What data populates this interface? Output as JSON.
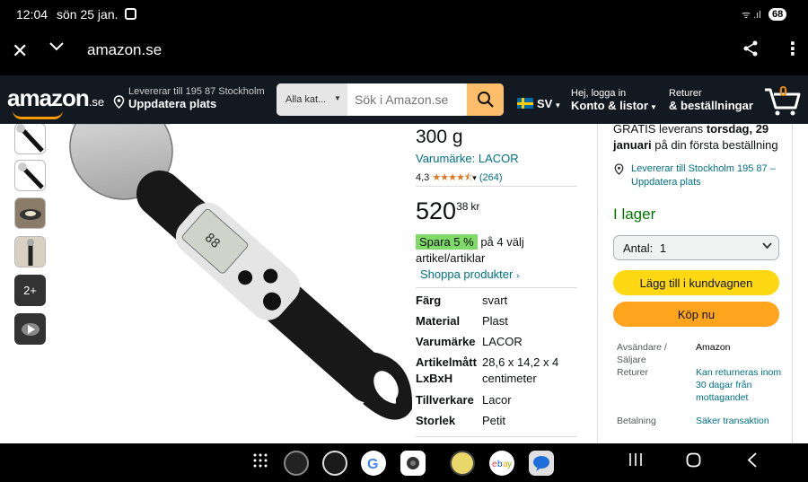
{
  "status": {
    "time": "12:04",
    "date": "sön 25 jan.",
    "signal": "ᯤ .ıl",
    "battery": "68"
  },
  "browser": {
    "close": "✕",
    "chevron": "⌄",
    "url": "amazon.se",
    "share": "⋰",
    "more": "⋮"
  },
  "header": {
    "logo": "amazon",
    "logo_suffix": ".se",
    "deliver_line1": "Levererar till 195 87 Stockholm",
    "deliver_line2": "Uppdatera plats",
    "search_category": "Alla kat...",
    "search_placeholder": "Sök i Amazon.se",
    "lang": "SV",
    "account_line1": "Hej, logga in",
    "account_line2": "Konto & listor",
    "returns_line1": "Returer",
    "returns_line2": "& beställningar",
    "cart_count": "0"
  },
  "thumbnails": {
    "more_label": "2+"
  },
  "product": {
    "title": "300 g",
    "brand": "Varumärke: LACOR",
    "rating_value": "4,3",
    "stars": "★★★★⯪",
    "rating_count": "(264)",
    "price_whole": "520",
    "price_fraction": "38",
    "price_currency": "kr",
    "deal_tag": "Spara 5 %",
    "deal_text": "på 4 välj artikel/artiklar",
    "shop_link": "Shoppa produkter",
    "specs": [
      {
        "key": "Färg",
        "value": "svart"
      },
      {
        "key": "Material",
        "value": "Plast"
      },
      {
        "key": "Varumärke",
        "value": "LACOR"
      },
      {
        "key": "Artikelmått LxBxH",
        "value": "28,6 x 14,2 x 4 centimeter"
      },
      {
        "key": "Tillverkare",
        "value": "Lacor"
      },
      {
        "key": "Storlek",
        "value": "Petit"
      }
    ]
  },
  "buybox": {
    "free_prefix": "GRATIS leverans",
    "free_date": "torsdag, 29 januari",
    "free_suffix": "på din första beställning",
    "address": "Levererar till Stockholm 195 87 – Uppdatera plats",
    "stock": "I lager",
    "qty_label": "Antal:",
    "qty_value": "1",
    "add_to_cart": "Lägg till i kundvagnen",
    "buy_now": "Köp nu",
    "info": [
      {
        "key": "Avsändare / Säljare",
        "value": "Amazon"
      },
      {
        "key": "Returer",
        "value": "Kan returneras inom 30 dagar från mottagandet"
      },
      {
        "key": "Betalning",
        "value": "Säker transaktion"
      }
    ]
  },
  "colors": {
    "amazon_dark": "#131921",
    "search_button": "#febd69",
    "cart_button": "#ffd814",
    "buy_button": "#ffa41c",
    "stock_green": "#007600",
    "link": "#007185",
    "deal_green": "#7fda69"
  },
  "icons": [
    "screenshot-icon",
    "close-icon",
    "chevron-down-icon",
    "share-icon",
    "more-icon",
    "location-pin-icon",
    "search-icon",
    "flag-se-icon",
    "cart-icon",
    "chevron-right-icon",
    "apps-grid-icon",
    "recent-apps-icon",
    "home-icon",
    "back-icon"
  ]
}
